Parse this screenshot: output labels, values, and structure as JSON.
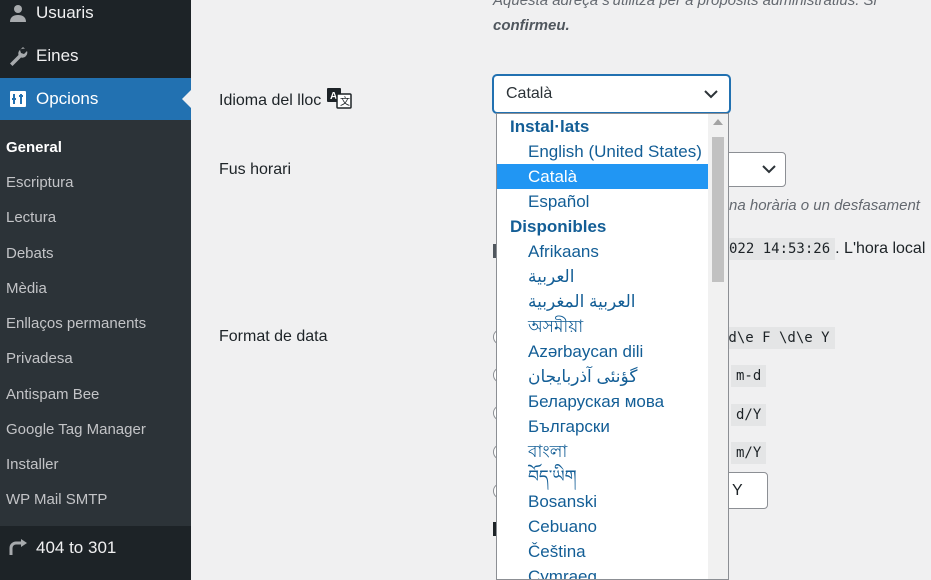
{
  "sidebar": {
    "top_items": [
      {
        "label": "Usuaris",
        "icon": "users-icon"
      },
      {
        "label": "Eines",
        "icon": "wrench-icon"
      },
      {
        "label": "Opcions",
        "icon": "settings-icon"
      }
    ],
    "submenu": [
      "General",
      "Escriptura",
      "Lectura",
      "Debats",
      "Mèdia",
      "Enllaços permanents",
      "Privadesa",
      "Antispam Bee",
      "Google Tag Manager",
      "Installer",
      "WP Mail SMTP"
    ],
    "bottom_item": {
      "label": "404 to 301",
      "icon": "redirect-icon"
    }
  },
  "main": {
    "email_desc_line1": "Aquesta adreça s'utilitza per a propòsits administratius. Si",
    "email_desc_line2": "confirmeu.",
    "site_language": {
      "label": "Idioma del lloc",
      "value": "Català",
      "icon": "translate-icon"
    },
    "timezone": {
      "label": "Fus horari",
      "desc_fragment": "na horària o un desfasament",
      "time_code": "022 14:53:26",
      "time_suffix": ". L'hora local"
    },
    "date_format": {
      "label": "Format de data",
      "codes": [
        "\\d\\e F \\d\\e Y",
        "m-d",
        "d/Y",
        "m/Y"
      ],
      "custom_value": "Y"
    }
  },
  "language_dropdown": {
    "installed_label": "Instal·lats",
    "installed": [
      "English (United States)",
      "Català",
      "Español"
    ],
    "available_label": "Disponibles",
    "available": [
      "Afrikaans",
      "العربية",
      "العربية المغربية",
      "অসমীয়া",
      "Azərbaycan dili",
      "گؤنئی آذربایجان",
      "Беларуская мова",
      "Български",
      "বাংলা",
      "བོད་ཡིག",
      "Bosanski",
      "Cebuano",
      "Čeština",
      "Cymraeg"
    ],
    "selected": "Català"
  },
  "colors": {
    "sidebar_bg": "#1d2327",
    "submenu_bg": "#2c3338",
    "accent": "#2271b1",
    "option_text": "#135e96",
    "selected_bg": "#2196f3"
  }
}
